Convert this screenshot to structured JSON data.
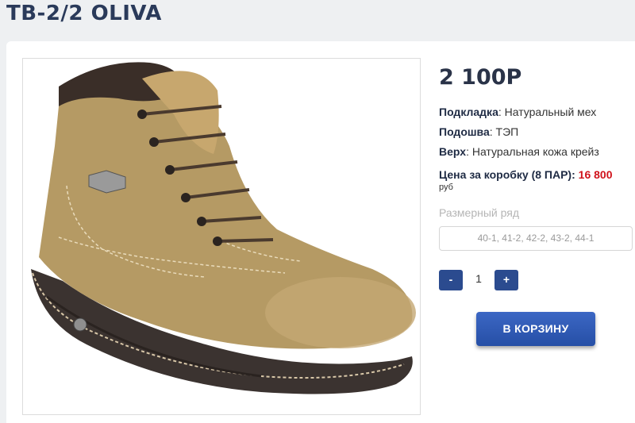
{
  "product": {
    "title": "TB-2/2 OLIVA",
    "image_alt": "boot"
  },
  "details": {
    "price": "2 100Р",
    "lining_label": "Подкладка",
    "lining_value": "Натуральный мех",
    "sole_label": "Подошва",
    "sole_value": "ТЭП",
    "upper_label": "Верх",
    "upper_value": "Натуральная кожа крейз",
    "box_label": "Цена за коробку (8 ПАР)",
    "box_value": "16 800",
    "currency": "руб"
  },
  "size": {
    "label": "Размерный ряд",
    "selected": "40-1, 41-2, 42-2, 43-2, 44-1"
  },
  "quantity": {
    "minus": "-",
    "value": "1",
    "plus": "+"
  },
  "cart": {
    "label": "В КОРЗИНУ"
  },
  "colors": {
    "accent": "#2b4b8f",
    "price_red": "#d0121b",
    "title": "#2a3a5a"
  }
}
